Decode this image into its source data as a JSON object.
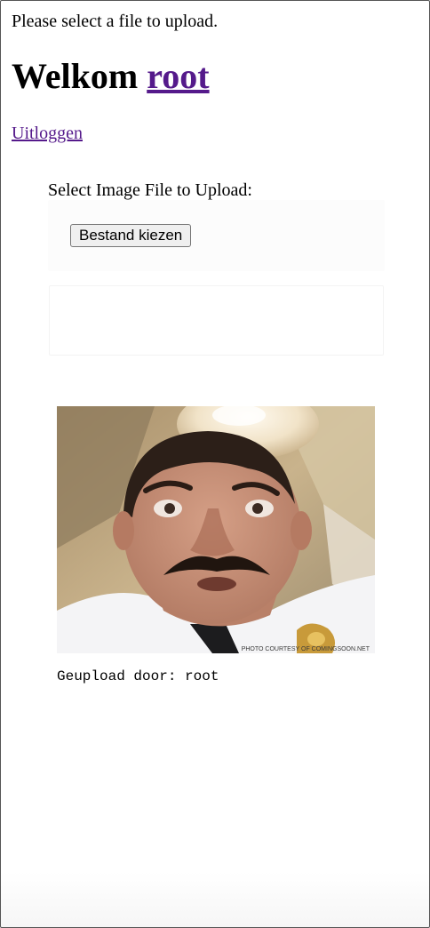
{
  "status_message": "Please select a file to upload.",
  "header": {
    "welcome_text": "Welkom",
    "username_link": "root"
  },
  "logout_link": "Uitloggen",
  "upload": {
    "label": "Select Image File to Upload:",
    "file_button": "Bestand kiezen"
  },
  "post": {
    "image_watermark": "PHOTO COURTESY OF COMINGSOON.NET",
    "caption": "Geupload door: root"
  },
  "colors": {
    "visited_link": "#551a8b",
    "button_bg": "#efefef"
  }
}
